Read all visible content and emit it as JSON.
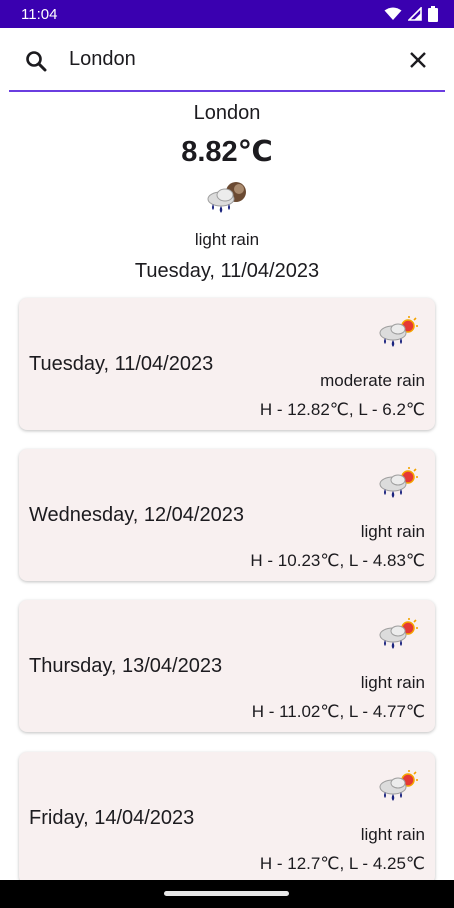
{
  "status_bar": {
    "time": "11:04"
  },
  "search": {
    "value": "London"
  },
  "current": {
    "city": "London",
    "temperature": "8.82℃",
    "condition": "light rain",
    "date": "Tuesday, 11/04/2023",
    "icon": "rain-cloud-moon-icon"
  },
  "forecast": [
    {
      "date": "Tuesday, 11/04/2023",
      "condition": "moderate rain",
      "high_low": "H - 12.82℃, L - 6.2℃",
      "icon": "rain-cloud-sun-icon"
    },
    {
      "date": "Wednesday, 12/04/2023",
      "condition": "light rain",
      "high_low": "H - 10.23℃, L - 4.83℃",
      "icon": "rain-cloud-sun-icon"
    },
    {
      "date": "Thursday, 13/04/2023",
      "condition": "light rain",
      "high_low": "H - 11.02℃, L - 4.77℃",
      "icon": "rain-cloud-sun-icon"
    },
    {
      "date": "Friday, 14/04/2023",
      "condition": "light rain",
      "high_low": "H - 12.7℃, L - 4.25℃",
      "icon": "rain-cloud-sun-icon"
    }
  ],
  "colors": {
    "status_bar": "#3a00b0",
    "accent": "#6a3de0",
    "card_bg": "#f8f0f0",
    "rain_drop": "#1a237e"
  }
}
